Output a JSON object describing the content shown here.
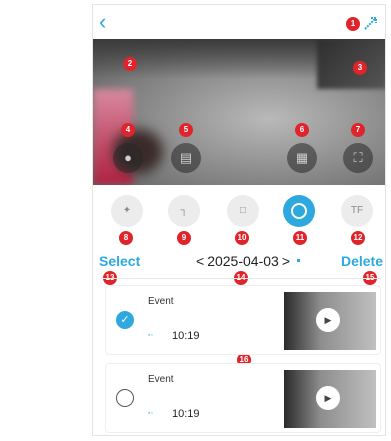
{
  "topbar": {
    "back_icon": "chevron-left-icon",
    "right_icon": "expand-icon"
  },
  "video": {
    "buttons": [
      {
        "name": "record",
        "icon": "record-icon"
      },
      {
        "name": "screenshot",
        "icon": "camera-icon"
      },
      {
        "name": "multi-view",
        "icon": "grid-icon"
      },
      {
        "name": "fullscreen",
        "icon": "fullscreen-icon"
      }
    ]
  },
  "toolbar": {
    "tools": [
      {
        "name": "tool-1",
        "icon": "sparkle-icon"
      },
      {
        "name": "tool-2",
        "icon": "frame-icon"
      },
      {
        "name": "tool-3",
        "icon": "figure-icon"
      },
      {
        "name": "tool-4",
        "icon": "circle-icon",
        "active": true
      },
      {
        "name": "tool-5",
        "icon": "tf-card-icon",
        "label": "TF"
      }
    ]
  },
  "markers": [
    "1",
    "2",
    "3",
    "4",
    "5",
    "6",
    "7",
    "8",
    "9",
    "10",
    "11",
    "12",
    "13",
    "14",
    "15",
    "16"
  ],
  "selectbar": {
    "select_label": "Select",
    "delete_label": "Delete",
    "date": "2025-04-03",
    "prev": "<",
    "next": ">"
  },
  "events": [
    {
      "title": "Event",
      "time": "10:19",
      "selected": true
    },
    {
      "title": "Event",
      "time": "10:19",
      "selected": false
    }
  ],
  "colors": {
    "accent": "#2da9e0",
    "marker": "#e0242b"
  }
}
